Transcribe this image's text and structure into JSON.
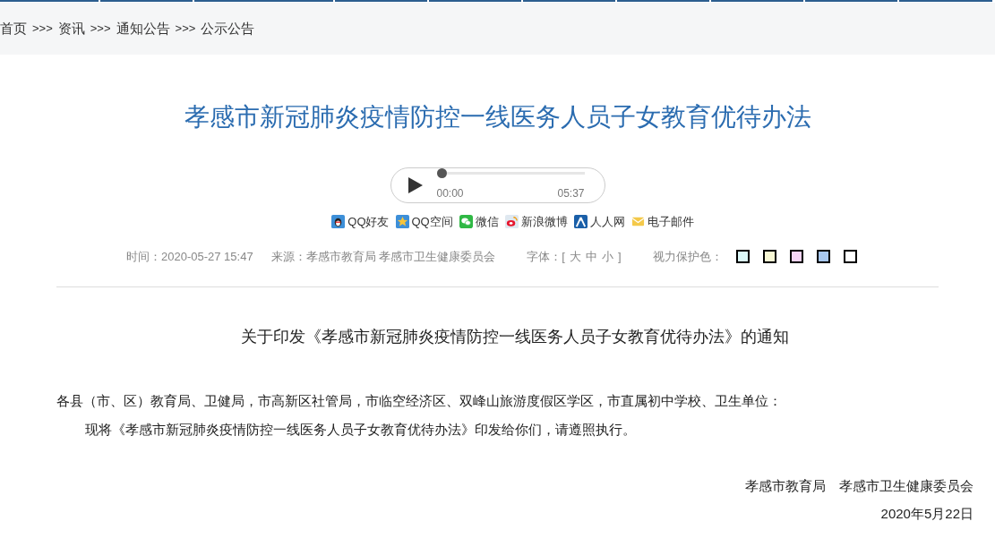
{
  "breadcrumb": [
    {
      "label": "首页",
      "sep": ">>>"
    },
    {
      "label": "资讯",
      "sep": ">>>"
    },
    {
      "label": "通知公告",
      "sep": ">>>"
    },
    {
      "label": "公示公告"
    }
  ],
  "title": "孝感市新冠肺炎疫情防控一线医务人员子女教育优待办法",
  "player": {
    "current": "00:00",
    "duration": "05:37",
    "level": 0
  },
  "share": [
    {
      "label": "QQ好友",
      "kind": "qq"
    },
    {
      "label": "QQ空间",
      "kind": "qzone"
    },
    {
      "label": "微信",
      "kind": "wechat"
    },
    {
      "label": "新浪微博",
      "kind": "weibo"
    },
    {
      "label": "人人网",
      "kind": "renren"
    },
    {
      "label": "电子邮件",
      "kind": "mail"
    }
  ],
  "meta": {
    "time": "时间：2020-05-27 15:47",
    "source": "来源：孝感市教育局 孝感市卫生健康委员会",
    "font_label": "字体：[",
    "font_sizes": [
      "大",
      "中",
      "小"
    ],
    "font_end": "]",
    "eye_label": "视力保护色：",
    "eye_colors": [
      {
        "color": "#dcf8f8"
      },
      {
        "color": "#f8f8d4"
      },
      {
        "color": "#f4d4f4"
      },
      {
        "color": "#a8c8f0"
      },
      {
        "color": "#ffffff"
      }
    ]
  },
  "article": {
    "heading": "关于印发《孝感市新冠肺炎疫情防控一线医务人员子女教育优待办法》的通知",
    "paragraphs": [
      {
        "text": "各县（市、区）教育局、卫健局，市高新区社管局，市临空经济区、双峰山旅游度假区学区，市直属初中学校、卫生单位：",
        "indent": false
      },
      {
        "text": "现将《孝感市新冠肺炎疫情防控一线医务人员子女教育优待办法》印发给你们，请遵照执行。",
        "indent": true
      }
    ],
    "signature": [
      "孝感市教育局　孝感市卫生健康委员会",
      "2020年5月22日"
    ]
  }
}
